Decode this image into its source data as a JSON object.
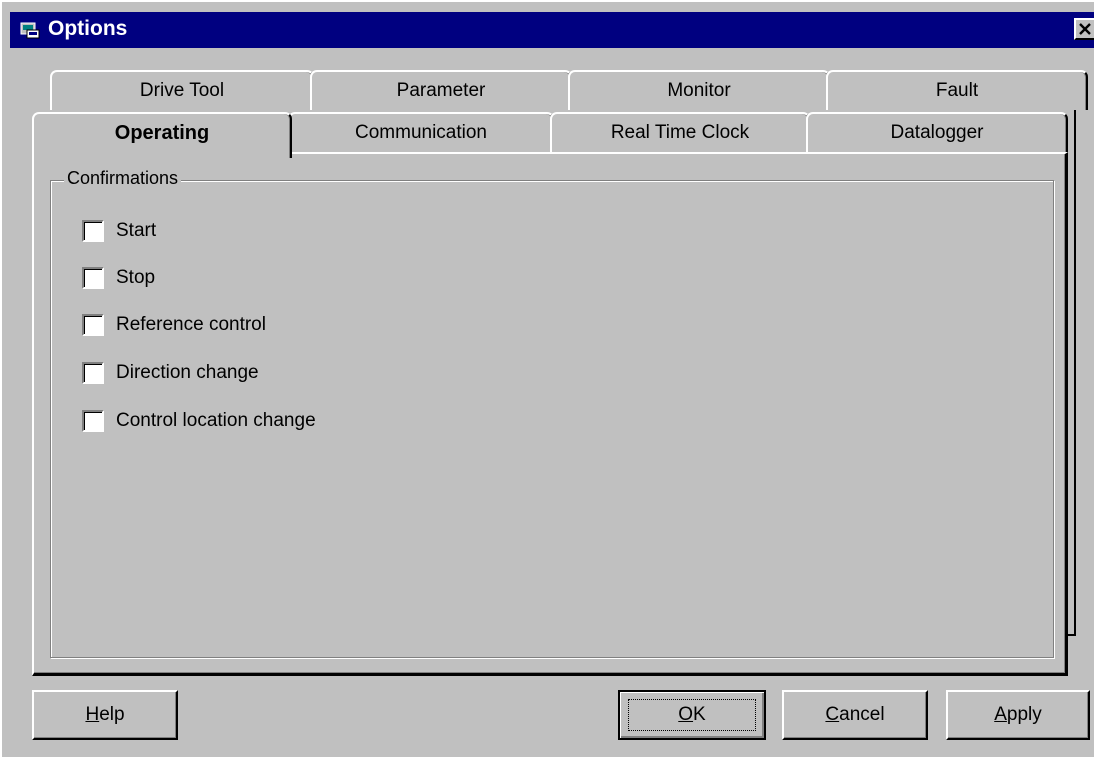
{
  "window": {
    "title": "Options",
    "icon": "app-window-icon",
    "close_icon": "close-icon"
  },
  "tabs": {
    "row_back": [
      {
        "label": "Drive Tool"
      },
      {
        "label": "Parameter"
      },
      {
        "label": "Monitor"
      },
      {
        "label": "Fault"
      }
    ],
    "row_front": [
      {
        "label": "Operating",
        "active": true
      },
      {
        "label": "Communication"
      },
      {
        "label": "Real Time Clock"
      },
      {
        "label": "Datalogger"
      }
    ]
  },
  "confirmations": {
    "group_label": "Confirmations",
    "items": [
      {
        "label": "Start",
        "checked": false
      },
      {
        "label": "Stop",
        "checked": false
      },
      {
        "label": "Reference control",
        "checked": false
      },
      {
        "label": "Direction change",
        "checked": false
      },
      {
        "label": "Control location change",
        "checked": false
      }
    ]
  },
  "buttons": {
    "help": {
      "mnemonic": "H",
      "rest": "elp"
    },
    "ok": {
      "mnemonic": "O",
      "rest": "K"
    },
    "cancel": {
      "mnemonic": "C",
      "rest": "ancel"
    },
    "apply": {
      "mnemonic": "A",
      "rest": "pply"
    }
  }
}
